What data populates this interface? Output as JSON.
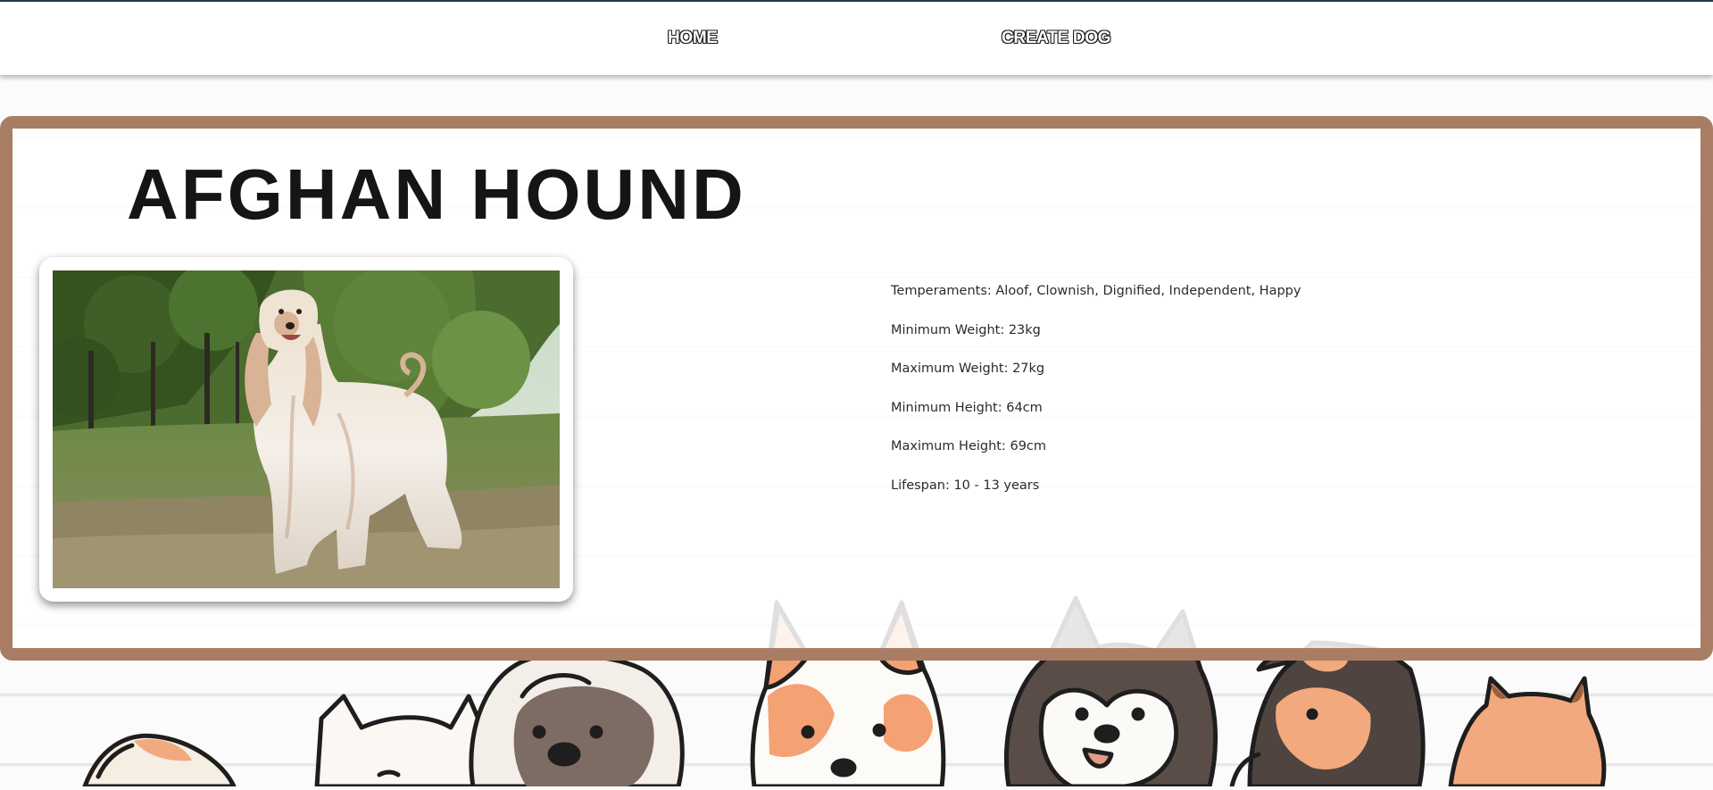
{
  "nav": {
    "home_label": "HOME",
    "create_label": "CREATE DOG"
  },
  "dog": {
    "name": "AFGHAN HOUND",
    "photo_alt": "Afghan Hound",
    "details": [
      {
        "label": "Temperaments: Aloof, Clownish, Dignified, Independent, Happy"
      },
      {
        "label": "Minimum Weight: 23kg"
      },
      {
        "label": "Maximum Weight: 27kg"
      },
      {
        "label": "Minimum Height: 64cm"
      },
      {
        "label": "Maximum Height: 69cm"
      },
      {
        "label": "Lifespan: 10 - 13 years"
      }
    ]
  },
  "colors": {
    "card_border": "#a87d63",
    "nav_border": "#1d3b52",
    "title_text": "#151515"
  },
  "icons": {
    "background_art": "cartoon-dogs-illustration",
    "photo": "afghan-hound-photo"
  }
}
